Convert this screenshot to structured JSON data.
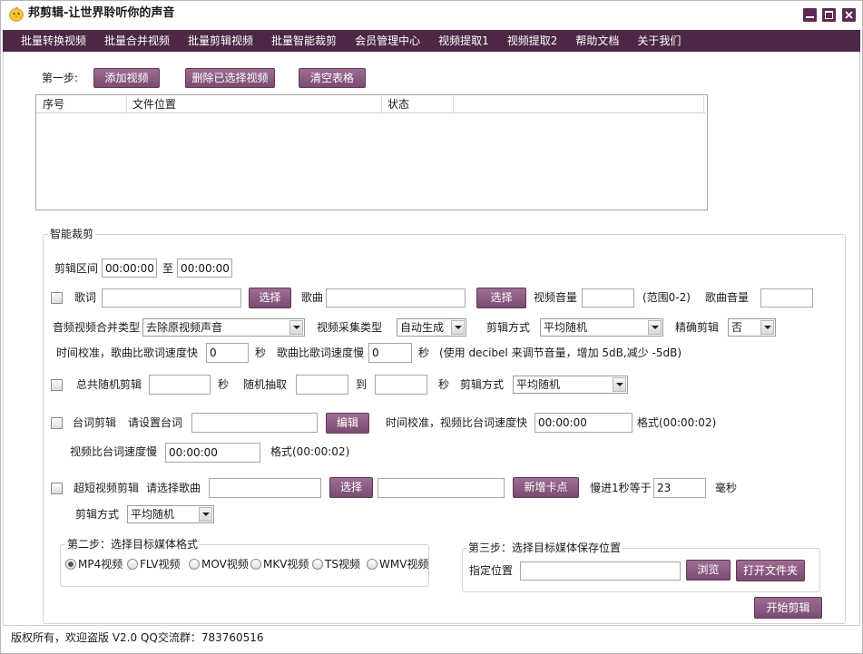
{
  "window": {
    "title": "邦剪辑-让世界聆听你的声音",
    "app_icon": "chick-icon",
    "minimize_icon": "minimize-icon",
    "maximize_icon": "maximize-icon",
    "close_icon": "close-icon"
  },
  "menu": {
    "items": [
      "批量转换视频",
      "批量合并视频",
      "批量剪辑视频",
      "批量智能裁剪",
      "会员管理中心",
      "视频提取1",
      "视频提取2",
      "帮助文档",
      "关于我们"
    ]
  },
  "step1": {
    "label": "第一步:",
    "add_video": "添加视频",
    "delete_selected": "删除已选择视频",
    "clear_table": "清空表格",
    "table": {
      "columns": [
        "序号",
        "文件位置",
        "状态"
      ],
      "rows": []
    }
  },
  "smart_cut": {
    "title": "智能裁剪",
    "range": {
      "label": "剪辑区间",
      "start": "00:00:00",
      "to": "至",
      "end": "00:00:00"
    },
    "lyrics": {
      "checked": false,
      "label": "歌词",
      "select_button": "选择"
    },
    "song": {
      "label": "歌曲",
      "select_button": "选择"
    },
    "video_volume": {
      "label": "视频音量",
      "hint": "(范围0-2)"
    },
    "song_volume": {
      "label": "歌曲音量"
    },
    "merge_type": {
      "label": "音频视频合并类型",
      "selected": "去除原视频声音"
    },
    "capture_type": {
      "label": "视频采集类型",
      "selected": "自动生成"
    },
    "cut_mode": {
      "label": "剪辑方式",
      "selected": "平均随机"
    },
    "precise_cut": {
      "label": "精确剪辑",
      "selected": "否"
    },
    "time_calibration": {
      "faster_label": "时间校准，歌曲比歌词速度快",
      "faster_value": "0",
      "sec": "秒",
      "slower_label": "歌曲比歌词速度慢",
      "slower_value": "0",
      "note": "(使用 decibel 来调节音量，增加 5dB,减少 -5dB)"
    },
    "random_cut": {
      "checked": false,
      "label": "总共随机剪辑",
      "sec": "秒",
      "extract_label": "随机抽取",
      "to": "到",
      "mode_label": "剪辑方式",
      "mode_selected": "平均随机"
    },
    "subtitle_cut": {
      "checked": false,
      "label": "台词剪辑",
      "prompt": "请设置台词",
      "edit_button": "编辑",
      "faster_label": "时间校准，视频比台词速度快",
      "faster_value": "00:00:00",
      "faster_format": "格式(00:00:02)",
      "slower_label": "视频比台词速度慢",
      "slower_value": "00:00:00",
      "slower_format": "格式(00:00:02)"
    },
    "short_video": {
      "checked": false,
      "label": "超短视频剪辑",
      "prompt": "请选择歌曲",
      "select_button": "选择",
      "add_beat_button": "新增卡点",
      "slow_label": "慢进1秒等于",
      "slow_value": "23",
      "unit": "毫秒",
      "mode_label": "剪辑方式",
      "mode_selected": "平均随机"
    }
  },
  "step2": {
    "title": "第二步：选择目标媒体格式",
    "formats": [
      "MP4视频",
      "FLV视频",
      "MOV视频",
      "MKV视频",
      "TS视频",
      "WMV视频"
    ],
    "selected_index": 0
  },
  "step3": {
    "title": "第三步：选择目标媒体保存位置",
    "location_label": "指定位置",
    "browse_button": "浏览",
    "open_folder_button": "打开文件夹"
  },
  "start_button": "开始剪辑",
  "status_bar": "版权所有，欢迎盗版 V2.0 QQ交流群：783760516",
  "colors": {
    "menu_bg": "#4d2845",
    "button_top": "#9d6d92",
    "button_bottom": "#7b4c71",
    "window_control": "#5b2b53",
    "group_border": "#d2d2d2"
  }
}
